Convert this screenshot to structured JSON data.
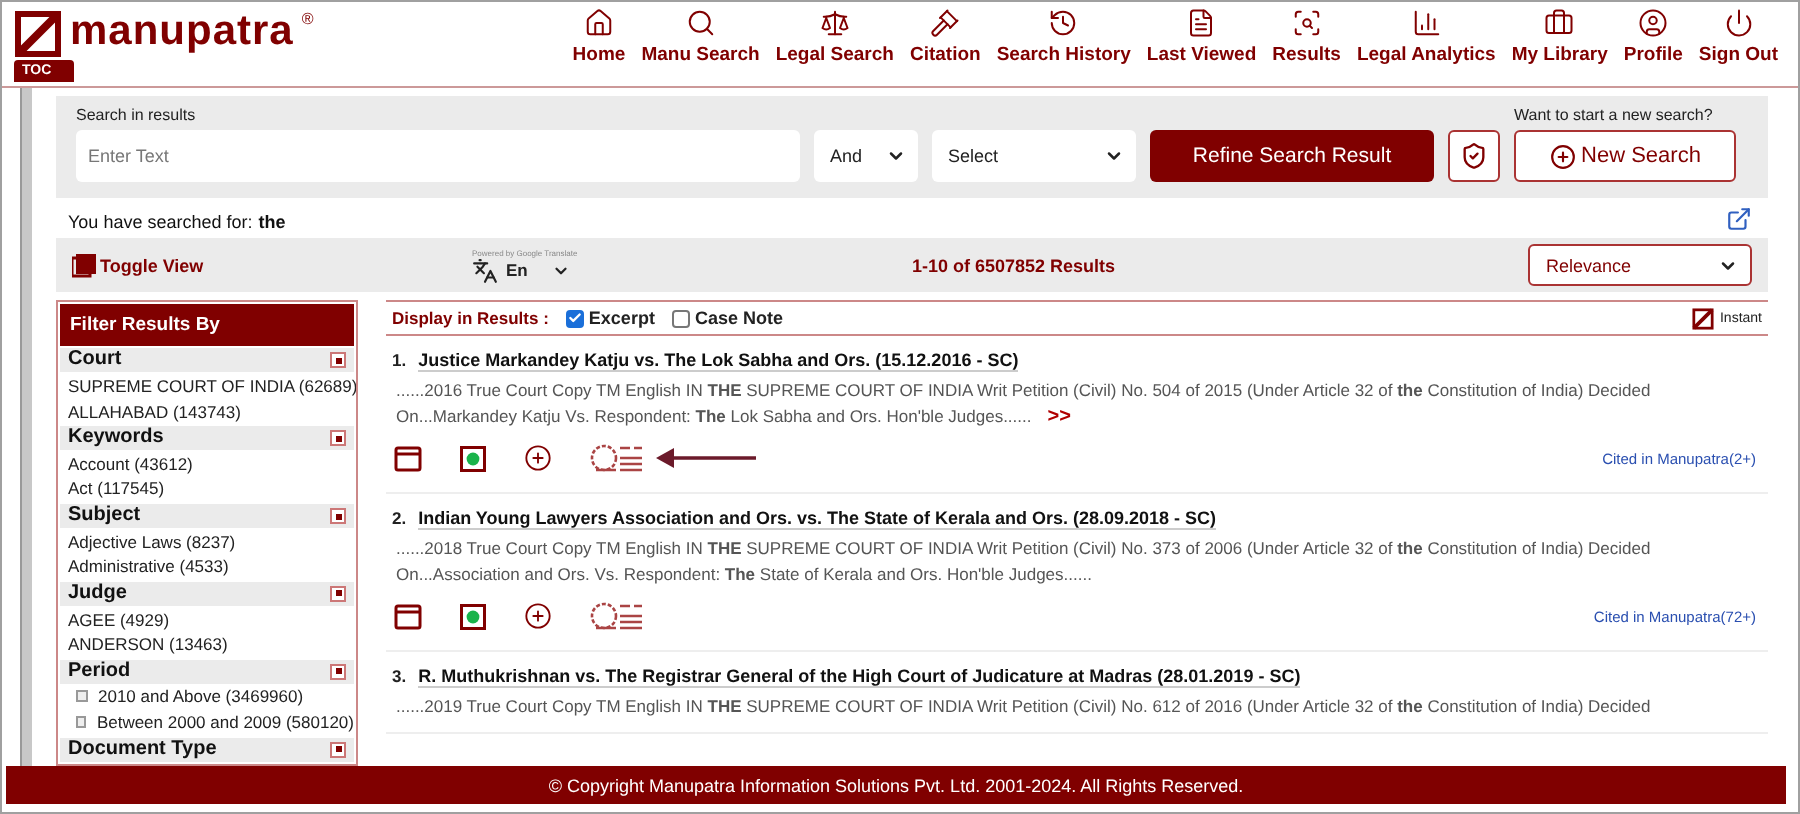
{
  "header": {
    "logo": "manupatra",
    "logo_mark": "®",
    "toc": "TOC",
    "nav": [
      {
        "label": "Home"
      },
      {
        "label": "Manu Search"
      },
      {
        "label": "Legal Search"
      },
      {
        "label": "Citation"
      },
      {
        "label": "Search History"
      },
      {
        "label": "Last Viewed"
      },
      {
        "label": "Results"
      },
      {
        "label": "Legal Analytics"
      },
      {
        "label": "My Library"
      },
      {
        "label": "Profile"
      },
      {
        "label": "Sign Out"
      }
    ]
  },
  "search_panel": {
    "label": "Search in results",
    "placeholder": "Enter Text",
    "operator": "And",
    "field": "Select",
    "refine_button": "Refine Search Result",
    "new_search_prompt": "Want to start a new search?",
    "new_search_button": "New Search"
  },
  "searched_for": {
    "label": "You have searched for:",
    "term": "the"
  },
  "toolbar": {
    "toggle_view": "Toggle View",
    "powered_by": "Powered by Google Translate",
    "language": "En",
    "results_count": "1-10 of 6507852 Results",
    "sort": "Relevance"
  },
  "filters": {
    "title": "Filter Results By",
    "groups": [
      {
        "name": "Court",
        "items": [
          {
            "label": "SUPREME COURT OF INDIA (62689)",
            "expandable": false
          },
          {
            "label": "ALLAHABAD (143743)",
            "expandable": false
          }
        ]
      },
      {
        "name": "Keywords",
        "items": [
          {
            "label": "Account (43612)",
            "expandable": false
          },
          {
            "label": "Act (117545)",
            "expandable": false
          }
        ]
      },
      {
        "name": "Subject",
        "items": [
          {
            "label": "Adjective Laws (8237)",
            "expandable": false
          },
          {
            "label": "Administrative (4533)",
            "expandable": false
          }
        ]
      },
      {
        "name": "Judge",
        "items": [
          {
            "label": "AGEE (4929)",
            "expandable": false
          },
          {
            "label": "ANDERSON (13463)",
            "expandable": false
          }
        ]
      },
      {
        "name": "Period",
        "items": [
          {
            "label": "2010 and Above (3469960)",
            "expandable": true
          },
          {
            "label": "Between 2000 and 2009 (580120)",
            "expandable": true
          }
        ]
      },
      {
        "name": "Document Type"
      }
    ]
  },
  "display": {
    "label": "Display in Results :",
    "options": [
      {
        "label": "Excerpt",
        "checked": true
      },
      {
        "label": "Case Note",
        "checked": false
      }
    ],
    "instant": "Instant"
  },
  "results": [
    {
      "number": "1.",
      "title": "Justice Markandey Katju vs. The Lok Sabha and Ors. (15.12.2016 - SC)",
      "excerpt": "......2016 True Court Copy TM English IN **THE** SUPREME COURT OF INDIA Writ Petition (Civil) No. 504 of 2015 (Under Article 32 of **the** Constitution of India) Decided On...Markandey Katju Vs. Respondent: **The** Lok Sabha and Ors. Hon'ble Judges......",
      "more": ">>",
      "actions": true,
      "highlighted": true,
      "cited": "Cited in Manupatra(2+)"
    },
    {
      "number": "2.",
      "title": "Indian Young Lawyers Association and Ors. vs. The State of Kerala and Ors. (28.09.2018 - SC)",
      "excerpt": "......2018 True Court Copy TM English IN **THE** SUPREME COURT OF INDIA Writ Petition (Civil) No. 373 of 2006 (Under Article 32 of **the** Constitution of India) Decided On...Association and Ors. Vs. Respondent: **The** State of Kerala and Ors. Hon'ble Judges......",
      "actions": true,
      "highlighted": false,
      "cited": "Cited in Manupatra(72+)"
    },
    {
      "number": "3.",
      "title": "R. Muthukrishnan vs. The Registrar General of the High Court of Judicature at Madras (28.01.2019 - SC)",
      "excerpt": "......2019 True Court Copy TM English IN **THE** SUPREME COURT OF INDIA Writ Petition (Civil) No. 612 of 2016 (Under Article 32 of **the** Constitution of India) Decided",
      "actions": false,
      "highlighted": false
    }
  ],
  "footer": "© Copyright Manupatra Information Solutions Pvt. Ltd. 2001-2024. All Rights Reserved."
}
